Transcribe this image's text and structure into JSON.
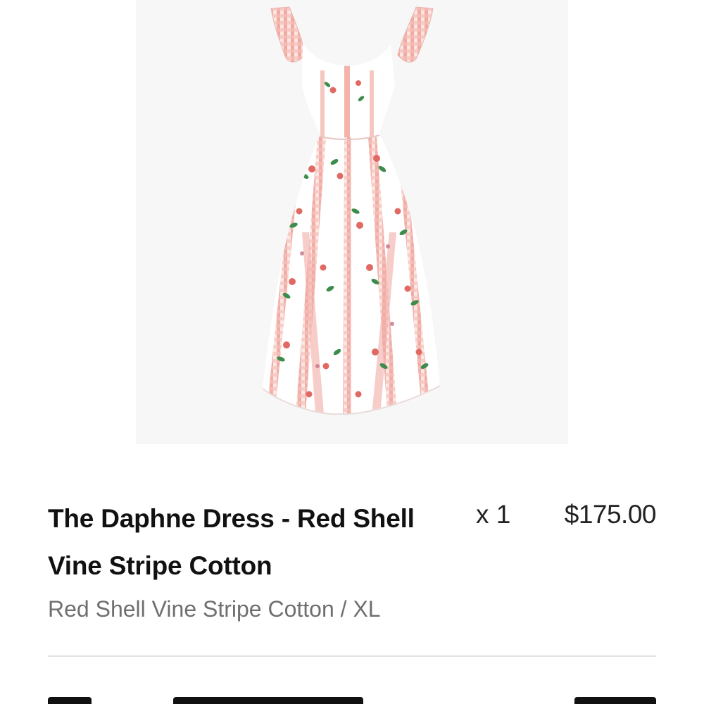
{
  "product": {
    "image_alt": "Floral ruffle-sleeve midi dress",
    "title": "The Daphne Dress - Red Shell Vine Stripe Cotton",
    "quantity": "x 1",
    "price": "$175.00",
    "variant": "Red Shell Vine Stripe Cotton / XL"
  },
  "colors": {
    "stripe": "#e5847c",
    "rose": "#e06a63",
    "leaf": "#3d8c4c",
    "background": "#f7f7f7"
  }
}
